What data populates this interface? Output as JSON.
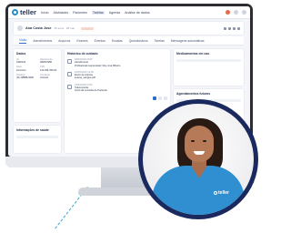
{
  "app": {
    "logo_text": "teller",
    "nav": [
      "Início",
      "Atividades",
      "Pacientes",
      "Tarefas",
      "Agenda",
      "Análise de dados"
    ],
    "active_nav": "Tarefas"
  },
  "patient": {
    "name": "Ana Costa Jose",
    "meta": "45 anos · 28 mai"
  },
  "tabs": [
    "Visão",
    "Atendimentos",
    "Arquivos",
    "Exames",
    "Eventos",
    "Escalas",
    "Questionários",
    "Tarefas",
    "Mensagens automáticas"
  ],
  "active_tab": "Visão",
  "dados": {
    "title": "Dados",
    "fields": [
      {
        "label": "ID",
        "value": "1990123"
      },
      {
        "label": "Nascimento",
        "value": "28/05/1980"
      },
      {
        "label": "Sexo",
        "value": "Feminino"
      },
      {
        "label": "CPF",
        "value": "123.456.789-00"
      },
      {
        "label": "Telefone",
        "value": "(11) 98888-0000"
      },
      {
        "label": "Convênio",
        "value": "Unimed"
      }
    ]
  },
  "informacoes": {
    "title": "Informações de saúde"
  },
  "historico": {
    "title": "Histórico de cuidado",
    "items": [
      {
        "date": "18/03/2024 8:00",
        "title": "Atendimento",
        "desc": "Profissional responsável: Dra. Ana Ribeiro"
      },
      {
        "date": "16/03/2024 12:00",
        "title": "Envio de Arquivo",
        "desc": "exame_sangue.pdf"
      },
      {
        "date": "15/03/2024 9:00",
        "title": "Teleconsulta",
        "desc": "Início da consulta do Paciente"
      }
    ]
  },
  "medicamentos": {
    "title": "Medicamentos em uso"
  },
  "agendamentos": {
    "title": "Agendamentos futuros"
  },
  "badge_text": "teller",
  "colors": {
    "brand_blue": "#2a8cc9",
    "navy": "#1b2a5e",
    "scrubs": "#2f8fd1"
  }
}
